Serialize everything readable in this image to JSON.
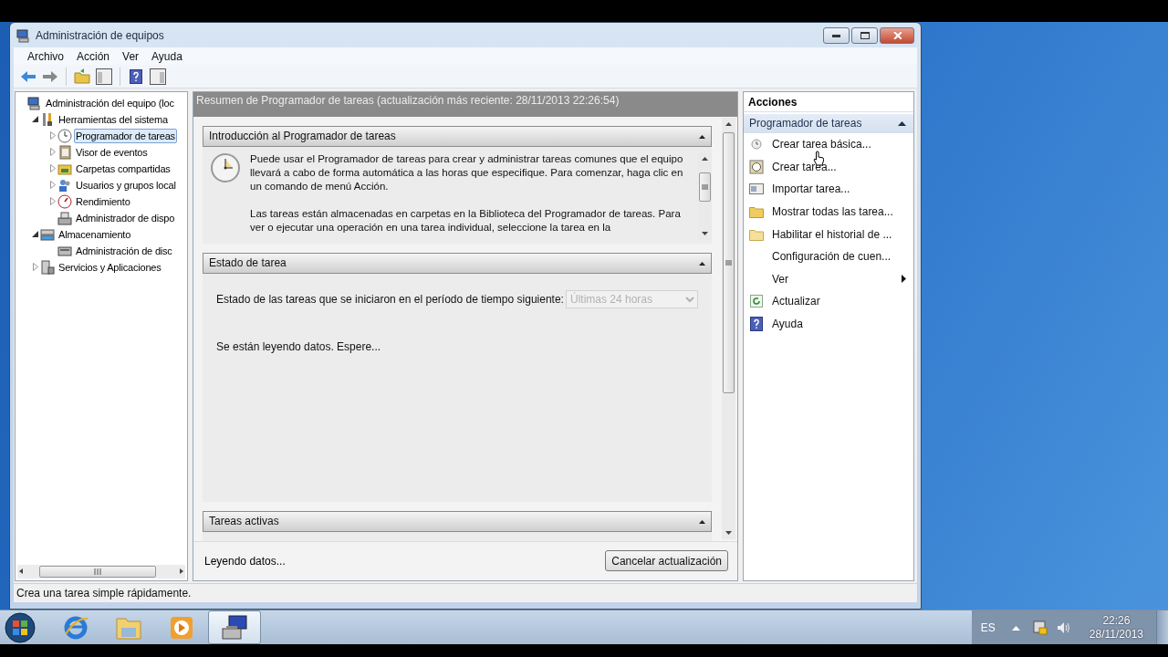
{
  "window": {
    "title": "Administración de equipos",
    "menu": [
      "Archivo",
      "Acción",
      "Ver",
      "Ayuda"
    ]
  },
  "tree": {
    "items": [
      {
        "label": "Administración del equipo (loc",
        "selected": false,
        "children": [
          {
            "label": "Herramientas del sistema",
            "selected": false,
            "expanded": true,
            "children": [
              {
                "label": "Programador de tareas",
                "selected": true,
                "expanded": false
              },
              {
                "label": "Visor de eventos",
                "selected": false,
                "expanded": false
              },
              {
                "label": "Carpetas compartidas",
                "selected": false,
                "expanded": false
              },
              {
                "label": "Usuarios y grupos local",
                "selected": false,
                "expanded": false
              },
              {
                "label": "Rendimiento",
                "selected": false,
                "expanded": false
              },
              {
                "label": "Administrador de dispo",
                "selected": false
              }
            ]
          },
          {
            "label": "Almacenamiento",
            "selected": false,
            "expanded": true,
            "children": [
              {
                "label": "Administración de disc",
                "selected": false
              }
            ]
          },
          {
            "label": "Servicios y Aplicaciones",
            "selected": false,
            "expanded": false
          }
        ]
      }
    ]
  },
  "summary": {
    "header": "Resumen de Programador de tareas (actualización más reciente: 28/11/2013 22:26:54)",
    "sections": [
      {
        "kind": "intro",
        "title": "Introducción al Programador de tareas",
        "expanded": true,
        "paragraphs": [
          "Puede usar el Programador de tareas para crear y administrar tareas comunes que el equipo llevará a cabo de forma automática a las horas que especifique. Para comenzar, haga clic en un comando de menú Acción.",
          "Las tareas están almacenadas en carpetas en la Biblioteca del Programador de tareas. Para ver o ejecutar una operación en una tarea individual, seleccione la tarea en la"
        ]
      },
      {
        "kind": "status",
        "title": "Estado de tarea",
        "expanded": true,
        "period_label": "Estado de las tareas que se iniciaron en el período de tiempo siguiente:",
        "period": {
          "value": "Últimas 24 horas",
          "disabled": true
        },
        "message": "Se están leyendo datos. Espere..."
      },
      {
        "kind": "active",
        "title": "Tareas activas",
        "expanded": true
      }
    ],
    "footer": {
      "status": "Leyendo datos...",
      "button": "Cancelar actualización"
    }
  },
  "actions": {
    "title": "Acciones",
    "section": {
      "title": "Programador de tareas",
      "expanded": true
    },
    "items": [
      {
        "kind": "command",
        "label": "Crear tarea básica..."
      },
      {
        "kind": "command",
        "label": "Crear tarea..."
      },
      {
        "kind": "command",
        "label": "Importar tarea..."
      },
      {
        "kind": "command",
        "label": "Mostrar todas las tarea..."
      },
      {
        "kind": "command",
        "label": "Habilitar el historial de ..."
      },
      {
        "kind": "command",
        "label": "Configuración de cuen..."
      },
      {
        "kind": "submenu",
        "label": "Ver"
      },
      {
        "kind": "command",
        "label": "Actualizar"
      },
      {
        "kind": "command",
        "label": "Ayuda"
      }
    ]
  },
  "status_bar": "Crea una tarea simple rápidamente.",
  "taskbar": {
    "apps": [
      {
        "selected": false
      },
      {
        "selected": false
      },
      {
        "selected": false
      },
      {
        "selected": true
      }
    ],
    "language": "ES",
    "time": "22:26",
    "date": "28/11/2013"
  }
}
